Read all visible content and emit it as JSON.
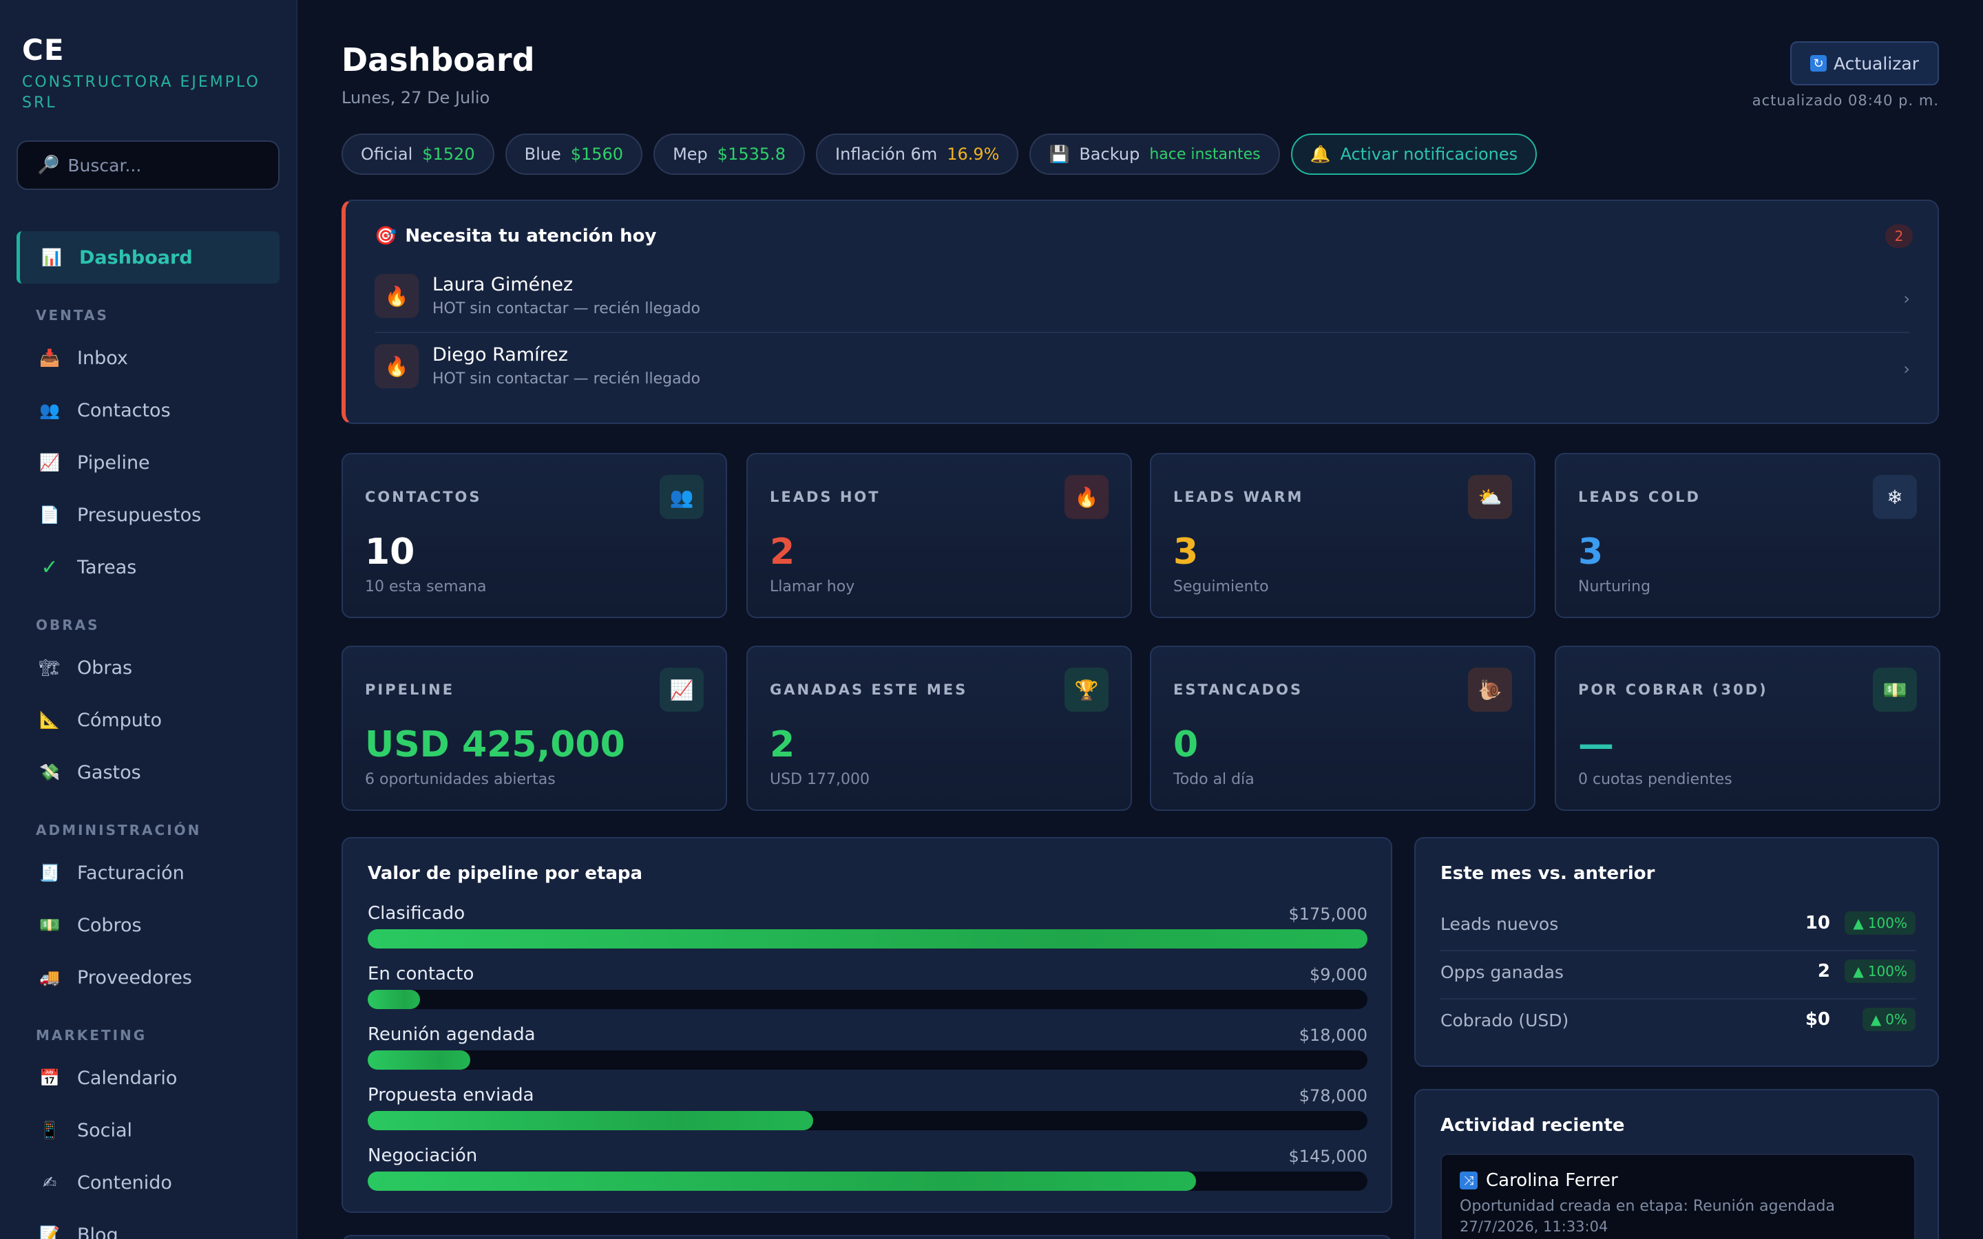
{
  "brand": {
    "mark": "CE",
    "name": "CONSTRUCTORA EJEMPLO SRL"
  },
  "search": {
    "placeholder": "Buscar...",
    "icon": "magnifier-icon"
  },
  "sidebar": {
    "active": {
      "label": "Dashboard",
      "icon": "chart-bar-icon"
    },
    "sections": [
      {
        "title": "VENTAS",
        "items": [
          {
            "label": "Inbox",
            "icon": "inbox-tray-icon"
          },
          {
            "label": "Contactos",
            "icon": "people-icon"
          },
          {
            "label": "Pipeline",
            "icon": "chart-up-icon"
          },
          {
            "label": "Presupuestos",
            "icon": "page-icon"
          },
          {
            "label": "Tareas",
            "icon": "checkmark-icon"
          }
        ]
      },
      {
        "title": "OBRAS",
        "items": [
          {
            "label": "Obras",
            "icon": "construction-crane-icon"
          },
          {
            "label": "Cómputo",
            "icon": "triangle-ruler-icon"
          },
          {
            "label": "Gastos",
            "icon": "money-wings-icon"
          }
        ]
      },
      {
        "title": "ADMINISTRACIÓN",
        "items": [
          {
            "label": "Facturación",
            "icon": "receipt-icon"
          },
          {
            "label": "Cobros",
            "icon": "banknote-icon"
          },
          {
            "label": "Proveedores",
            "icon": "truck-icon"
          }
        ]
      },
      {
        "title": "MARKETING",
        "items": [
          {
            "label": "Calendario",
            "icon": "calendar-icon"
          },
          {
            "label": "Social",
            "icon": "phone-icon"
          },
          {
            "label": "Contenido",
            "icon": "pencil-icon"
          },
          {
            "label": "Blog",
            "icon": "memo-icon"
          }
        ]
      }
    ]
  },
  "header": {
    "title": "Dashboard",
    "date": "Lunes, 27 De Julio",
    "refresh_label": "Actualizar",
    "updated": "actualizado 08:40 p. m."
  },
  "chips": [
    {
      "label": "Oficial",
      "value": "$1520"
    },
    {
      "label": "Blue",
      "value": "$1560"
    },
    {
      "label": "Mep",
      "value": "$1535.8"
    },
    {
      "label": "Inflación 6m",
      "value": "16.9%"
    },
    {
      "label": "Backup",
      "value": "hace instantes"
    },
    {
      "label": "Activar notificaciones"
    }
  ],
  "attention": {
    "title": "Necesita tu atención hoy",
    "count": "2",
    "items": [
      {
        "name": "Laura Giménez",
        "detail": "HOT sin contactar — recién llegado"
      },
      {
        "name": "Diego Ramírez",
        "detail": "HOT sin contactar — recién llegado"
      }
    ]
  },
  "stats_row1": [
    {
      "label": "CONTACTOS",
      "value": "10",
      "sub": "10 esta semana",
      "icon": "people-icon",
      "color": "#ffffff"
    },
    {
      "label": "LEADS HOT",
      "value": "2",
      "sub": "Llamar hoy",
      "icon": "fire-icon",
      "color": "#e8523d"
    },
    {
      "label": "LEADS WARM",
      "value": "3",
      "sub": "Seguimiento",
      "icon": "sun-cloud-icon",
      "color": "#f3b321"
    },
    {
      "label": "LEADS COLD",
      "value": "3",
      "sub": "Nurturing",
      "icon": "snowflake-icon",
      "color": "#3b9cf0"
    }
  ],
  "stats_row2": [
    {
      "label": "PIPELINE",
      "value": "USD 425,000",
      "sub": "6 oportunidades abiertas",
      "icon": "chart-up-icon",
      "color": "#2fd06a"
    },
    {
      "label": "GANADAS ESTE MES",
      "value": "2",
      "sub": "USD 177,000",
      "icon": "trophy-icon",
      "color": "#2fd06a"
    },
    {
      "label": "ESTANCADOS",
      "value": "0",
      "sub": "Todo al día",
      "icon": "snail-icon",
      "color": "#2fd06a"
    },
    {
      "label": "POR COBRAR (30D)",
      "value": "—",
      "sub": "0 cuotas pendientes",
      "icon": "banknote-icon",
      "color": "#2cc3ae"
    }
  ],
  "pipeline": {
    "title": "Valor de pipeline por etapa",
    "stages": [
      {
        "name": "Clasificado",
        "amount": "$175,000",
        "value": 175000
      },
      {
        "name": "En contacto",
        "amount": "$9,000",
        "value": 9000
      },
      {
        "name": "Reunión agendada",
        "amount": "$18,000",
        "value": 18000
      },
      {
        "name": "Propuesta enviada",
        "amount": "$78,000",
        "value": 78000
      },
      {
        "name": "Negociación",
        "amount": "$145,000",
        "value": 145000
      }
    ]
  },
  "compare": {
    "title": "Este mes vs. anterior",
    "rows": [
      {
        "name": "Leads nuevos",
        "value": "10",
        "change": "100%"
      },
      {
        "name": "Opps ganadas",
        "value": "2",
        "change": "100%"
      },
      {
        "name": "Cobrado (USD)",
        "value": "$0",
        "change": "0%"
      }
    ]
  },
  "activity": {
    "title": "Actividad reciente",
    "items": [
      {
        "name": "Carolina Ferrer",
        "desc": "Oportunidad creada en etapa: Reunión agendada",
        "time": "27/7/2026, 11:33:04"
      }
    ]
  }
}
